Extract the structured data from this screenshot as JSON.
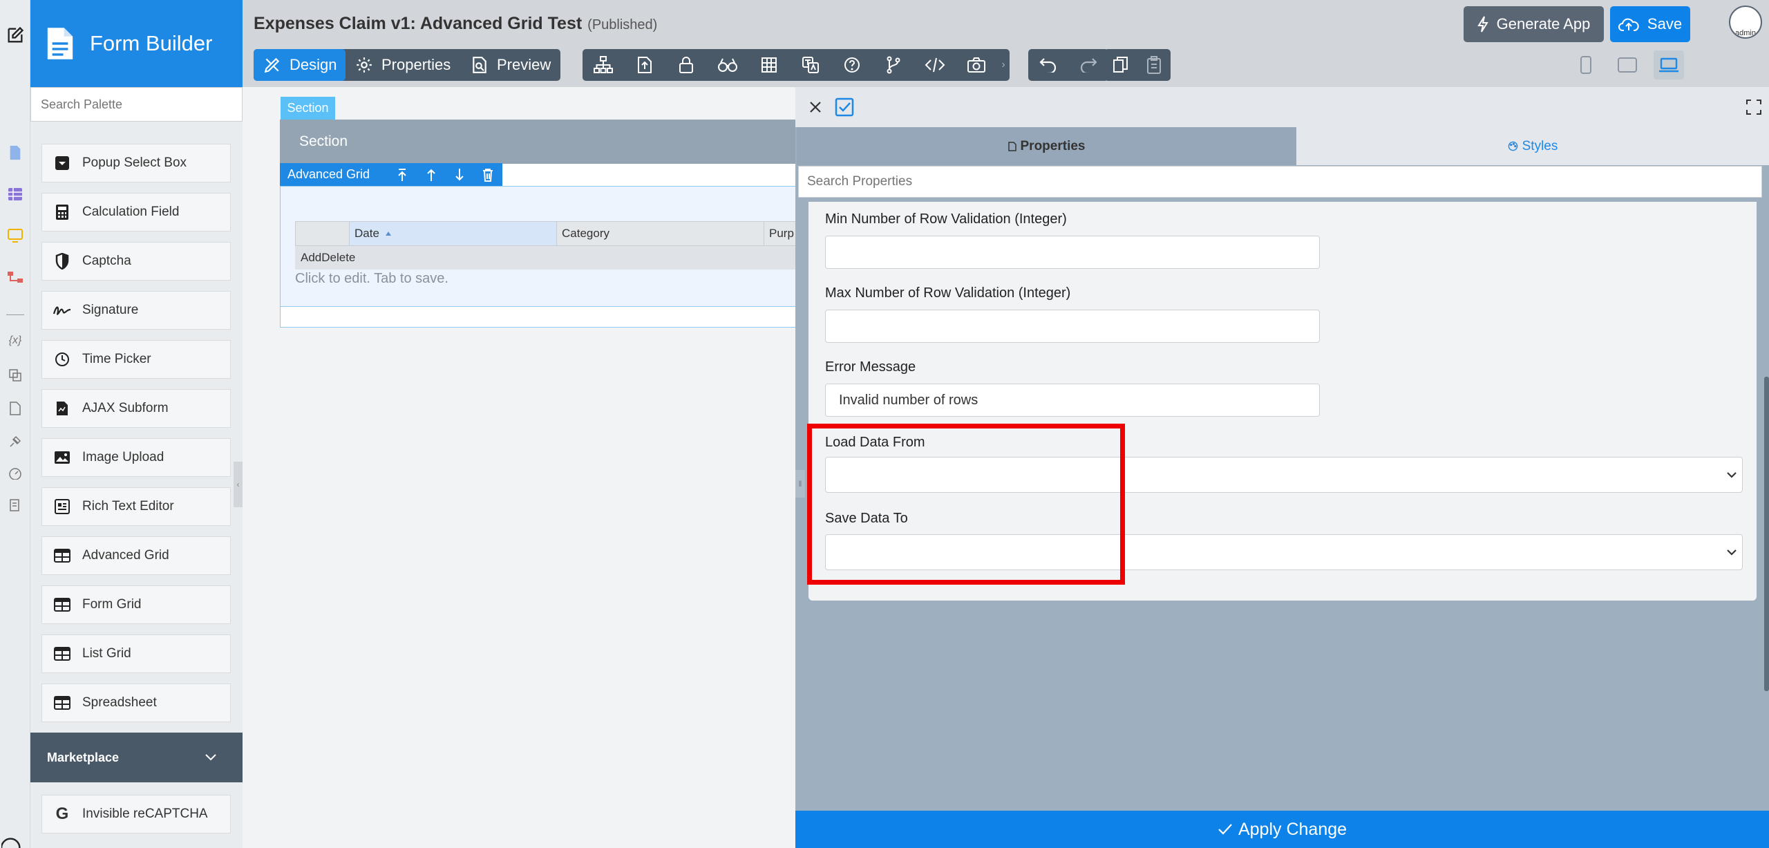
{
  "palette": {
    "title": "Form Builder",
    "search_placeholder": "Search Palette",
    "items": [
      {
        "label": "Popup Select Box",
        "icon": "popup-select-icon"
      },
      {
        "label": "Calculation Field",
        "icon": "calculator-icon"
      },
      {
        "label": "Captcha",
        "icon": "shield-icon"
      },
      {
        "label": "Signature",
        "icon": "signature-icon"
      },
      {
        "label": "Time Picker",
        "icon": "clock-icon"
      },
      {
        "label": "AJAX Subform",
        "icon": "document-icon"
      },
      {
        "label": "Image Upload",
        "icon": "image-icon"
      },
      {
        "label": "Rich Text Editor",
        "icon": "rich-text-icon"
      },
      {
        "label": "Advanced Grid",
        "icon": "table-icon"
      },
      {
        "label": "Form Grid",
        "icon": "table-icon"
      },
      {
        "label": "List Grid",
        "icon": "table-icon"
      },
      {
        "label": "Spreadsheet",
        "icon": "table-icon"
      }
    ],
    "marketplace_label": "Marketplace",
    "marketplace_items": [
      {
        "label": "Invisible reCAPTCHA",
        "icon": "google-g-icon"
      }
    ]
  },
  "header": {
    "title": "Expenses Claim v1: Advanced Grid Test",
    "status": "(Published)",
    "tabs": [
      {
        "label": "Design",
        "icon": "design-icon",
        "active": true
      },
      {
        "label": "Properties",
        "icon": "gear-icon",
        "active": false
      },
      {
        "label": "Preview",
        "icon": "preview-icon",
        "active": false
      }
    ],
    "generate_label": "Generate App",
    "save_label": "Save",
    "avatar_text": "admin"
  },
  "canvas": {
    "section_tag": "Section",
    "section_header": "Section",
    "grid_tag": "Advanced Grid",
    "columns": [
      "Date",
      "Category",
      "Purp"
    ],
    "row_text": "AddDelete",
    "hint": "Click to edit. Tab to save."
  },
  "properties": {
    "tab_properties": "Properties",
    "tab_styles": "Styles",
    "search_placeholder": "Search Properties",
    "min_rows_label": "Min Number of Row Validation (Integer)",
    "min_rows_value": "",
    "max_rows_label": "Max Number of Row Validation (Integer)",
    "max_rows_value": "",
    "error_label": "Error Message",
    "error_value": "Invalid number of rows",
    "load_label": "Load Data From",
    "load_value": "",
    "save_label": "Save Data To",
    "save_value": "",
    "apply_label": "Apply Change"
  },
  "colors": {
    "primary": "#1e88e5",
    "highlight": "#ee0000",
    "panel_bg": "#9eb0c0"
  }
}
